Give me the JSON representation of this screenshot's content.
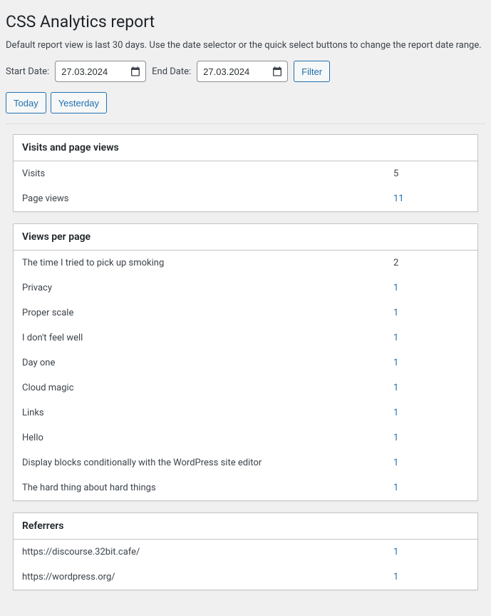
{
  "title": "CSS Analytics report",
  "description": "Default report view is last 30 days. Use the date selector or the quick select buttons to change the report date range.",
  "form": {
    "start_label": "Start Date:",
    "start_value": "27.03.2024",
    "end_label": "End Date:",
    "end_value": "27.03.2024",
    "filter_label": "Filter",
    "today_label": "Today",
    "yesterday_label": "Yesterday"
  },
  "widgets": {
    "visits": {
      "title": "Visits and page views",
      "rows": [
        {
          "label": "Visits",
          "value": "5",
          "link": false
        },
        {
          "label": "Page views",
          "value": "11",
          "link": true
        }
      ]
    },
    "perpage": {
      "title": "Views per page",
      "rows": [
        {
          "label": "The time I tried to pick up smoking",
          "value": "2",
          "link": false
        },
        {
          "label": "Privacy",
          "value": "1",
          "link": true
        },
        {
          "label": "Proper scale",
          "value": "1",
          "link": true
        },
        {
          "label": "I don't feel well",
          "value": "1",
          "link": true
        },
        {
          "label": "Day one",
          "value": "1",
          "link": true
        },
        {
          "label": "Cloud magic",
          "value": "1",
          "link": true
        },
        {
          "label": "Links",
          "value": "1",
          "link": true
        },
        {
          "label": "Hello",
          "value": "1",
          "link": true
        },
        {
          "label": "Display blocks conditionally with the WordPress site editor",
          "value": "1",
          "link": true
        },
        {
          "label": "The hard thing about hard things",
          "value": "1",
          "link": true
        }
      ]
    },
    "referrers": {
      "title": "Referrers",
      "rows": [
        {
          "label": "https://discourse.32bit.cafe/",
          "value": "1",
          "link": true
        },
        {
          "label": "https://wordpress.org/",
          "value": "1",
          "link": true
        }
      ]
    }
  }
}
